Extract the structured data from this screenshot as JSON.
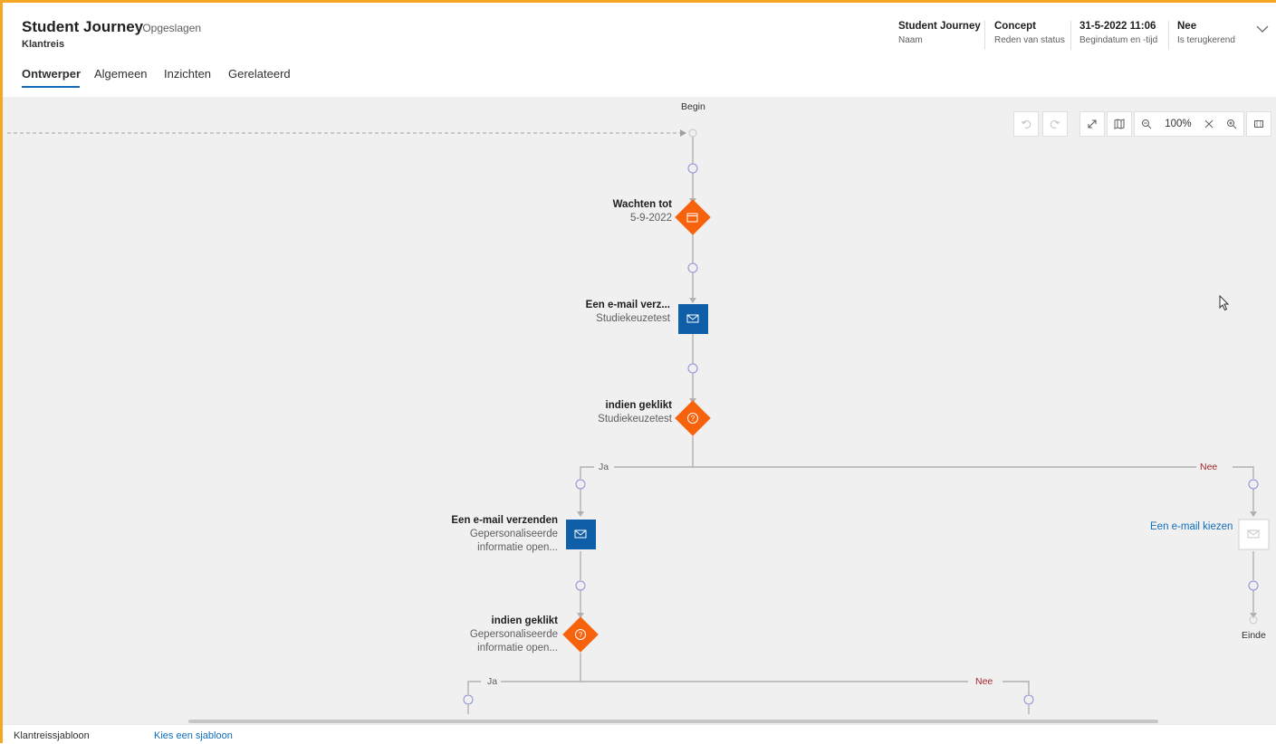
{
  "header": {
    "title": "Student Journey",
    "saved_status": "- Opgeslagen",
    "entity": "Klantreis",
    "fields": [
      {
        "value": "Student Journey",
        "label": "Naam"
      },
      {
        "value": "Concept",
        "label": "Reden van status"
      },
      {
        "value": "31-5-2022 11:06",
        "label": "Begindatum en -tijd"
      },
      {
        "value": "Nee",
        "label": "Is terugkerend"
      }
    ]
  },
  "tabs": [
    {
      "label": "Ontwerper",
      "active": true
    },
    {
      "label": "Algemeen"
    },
    {
      "label": "Inzichten"
    },
    {
      "label": "Gerelateerd"
    }
  ],
  "toolbar": {
    "zoom": "100%"
  },
  "canvas": {
    "begin": "Begin",
    "end": "Einde",
    "nodes": {
      "wait": {
        "title": "Wachten tot",
        "subtitle": "5-9-2022"
      },
      "email1": {
        "title": "Een e-mail verz...",
        "subtitle": "Studiekeuzetest"
      },
      "cond1": {
        "title": "indien geklikt",
        "subtitle": "Studiekeuzetest"
      },
      "email2": {
        "title": "Een e-mail verzenden",
        "subtitle1": "Gepersonaliseerde",
        "subtitle2": "informatie open..."
      },
      "cond2": {
        "title": "indien geklikt",
        "subtitle1": "Gepersonaliseerde",
        "subtitle2": "informatie open..."
      },
      "choose_email": "Een e-mail kiezen"
    },
    "branches": {
      "yes": "Ja",
      "no": "Nee"
    }
  },
  "footer": {
    "label": "Klantreissjabloon",
    "link": "Kies een sjabloon"
  },
  "colors": {
    "accent": "#0f6cbd",
    "condition": "#f7630c",
    "email_tile": "#0f5fa8",
    "frame": "#f5a623",
    "no_branch": "#a4262c"
  }
}
